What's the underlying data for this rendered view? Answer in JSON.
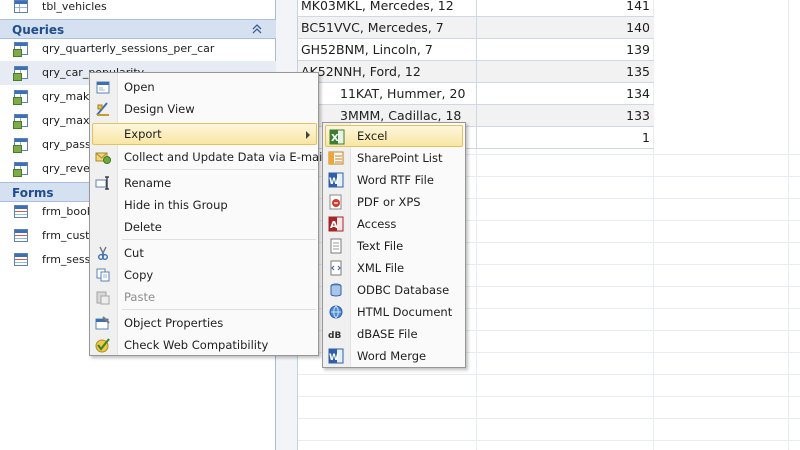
{
  "nav": {
    "top_item": "tbl_vehicles",
    "queries_header": "Queries",
    "queries": [
      "qry_quarterly_sessions_per_car",
      "qry_car_popularity",
      "qry_make",
      "qry_max",
      "qry_pass",
      "qry_rever"
    ],
    "forms_header": "Forms",
    "forms": [
      "frm_book",
      "frm_custo",
      "frm_sessi"
    ]
  },
  "datasheet": {
    "rows": [
      {
        "label": "MK03MKL, Mercedes, 12",
        "value": "141"
      },
      {
        "label": "BC51VVC, Mercedes, 7",
        "value": "140"
      },
      {
        "label": "GH52BNM, Lincoln, 7",
        "value": "139"
      },
      {
        "label": "AK52NNH, Ford, 12",
        "value": "135"
      },
      {
        "label": "11KAT, Hummer, 20",
        "value": "134"
      },
      {
        "label": "3MMM, Cadillac, 18",
        "value": "133"
      },
      {
        "label": "",
        "value": "1"
      }
    ]
  },
  "context_menu": {
    "items": [
      {
        "icon": "open-icon",
        "label": "Open"
      },
      {
        "icon": "design-view-icon",
        "label": "Design View"
      },
      {
        "icon": "",
        "label": "Export"
      },
      {
        "icon": "collect-data-icon",
        "label": "Collect and Update Data via E-mail"
      },
      {
        "icon": "rename-icon",
        "label": "Rename"
      },
      {
        "icon": "",
        "label": "Hide in this Group"
      },
      {
        "icon": "",
        "label": "Delete"
      },
      {
        "icon": "cut-icon",
        "label": "Cut"
      },
      {
        "icon": "copy-icon",
        "label": "Copy"
      },
      {
        "icon": "paste-icon",
        "label": "Paste"
      },
      {
        "icon": "object-properties-icon",
        "label": "Object Properties"
      },
      {
        "icon": "web-compatibility-icon",
        "label": "Check Web Compatibility"
      }
    ]
  },
  "export_menu": {
    "items": [
      {
        "icon": "excel-icon",
        "label": "Excel"
      },
      {
        "icon": "sharepoint-list-icon",
        "label": "SharePoint List"
      },
      {
        "icon": "word-rtf-icon",
        "label": "Word RTF File"
      },
      {
        "icon": "pdf-xps-icon",
        "label": "PDF or XPS"
      },
      {
        "icon": "access-icon",
        "label": "Access"
      },
      {
        "icon": "text-file-icon",
        "label": "Text File"
      },
      {
        "icon": "xml-file-icon",
        "label": "XML File"
      },
      {
        "icon": "odbc-database-icon",
        "label": "ODBC Database"
      },
      {
        "icon": "html-document-icon",
        "label": "HTML Document"
      },
      {
        "icon": "dbase-file-icon",
        "label": "dBASE File"
      },
      {
        "icon": "word-merge-icon",
        "label": "Word Merge"
      }
    ]
  },
  "colors": {
    "group_header_bg": "#d5e1f1",
    "group_header_text": "#1f4e8c",
    "highlight_border": "#e6c25a",
    "highlight_bg": "#f9e6a3"
  }
}
